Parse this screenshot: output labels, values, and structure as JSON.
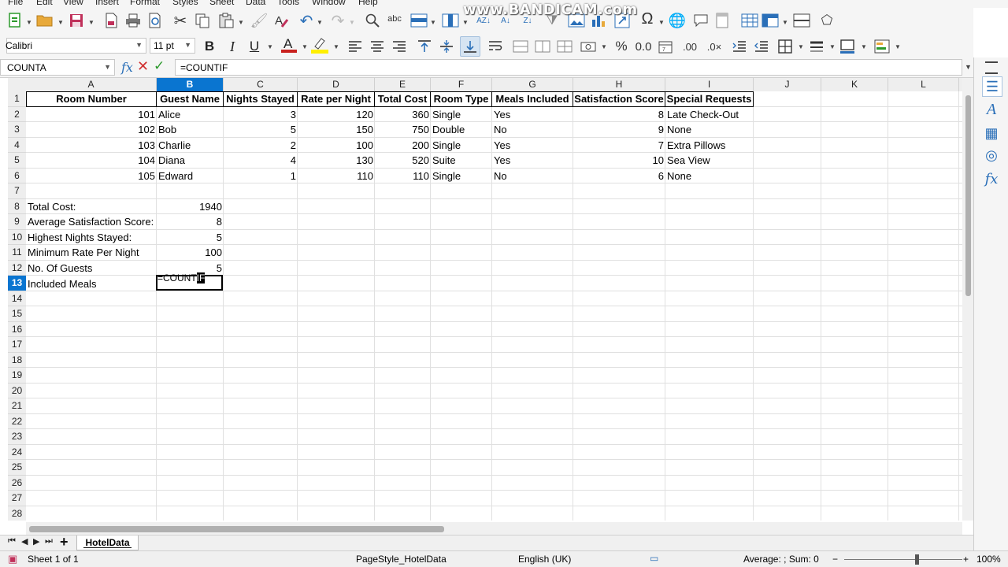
{
  "menu": [
    "File",
    "Edit",
    "View",
    "Insert",
    "Format",
    "Styles",
    "Sheet",
    "Data",
    "Tools",
    "Window",
    "Help"
  ],
  "watermark": "www.BANDICAM.com",
  "font": {
    "name": "Calibri",
    "size": "11 pt"
  },
  "formula_bar": {
    "name_box": "COUNTA",
    "formula": "=COUNTIF"
  },
  "columns": [
    "A",
    "B",
    "C",
    "D",
    "E",
    "F",
    "G",
    "H",
    "I",
    "J",
    "K",
    "L"
  ],
  "selected_column": "B",
  "rows": [
    "1",
    "2",
    "3",
    "4",
    "5",
    "6",
    "7",
    "8",
    "9",
    "10",
    "11",
    "12",
    "13",
    "14",
    "15",
    "16",
    "17",
    "18",
    "19",
    "20",
    "21",
    "22",
    "23",
    "24",
    "25",
    "26",
    "27",
    "28"
  ],
  "selected_row": "13",
  "table": {
    "headers": [
      "Room Number",
      "Guest Name",
      "Nights Stayed",
      "Rate per Night",
      "Total Cost",
      "Room Type",
      "Meals Included",
      "Satisfaction Score",
      "Special Requests"
    ],
    "rows": [
      [
        "101",
        "Alice",
        "3",
        "120",
        "360",
        "Single",
        "Yes",
        "8",
        "Late Check-Out"
      ],
      [
        "102",
        "Bob",
        "5",
        "150",
        "750",
        "Double",
        "No",
        "9",
        "None"
      ],
      [
        "103",
        "Charlie",
        "2",
        "100",
        "200",
        "Single",
        "Yes",
        "7",
        "Extra Pillows"
      ],
      [
        "104",
        "Diana",
        "4",
        "130",
        "520",
        "Suite",
        "Yes",
        "10",
        "Sea View"
      ],
      [
        "105",
        "Edward",
        "1",
        "110",
        "110",
        "Single",
        "No",
        "6",
        "None"
      ]
    ]
  },
  "summary": [
    {
      "label": "Total Cost:",
      "value": "1940"
    },
    {
      "label": "Average Satisfaction Score:",
      "value": "8"
    },
    {
      "label": "Highest Nights Stayed:",
      "value": "5"
    },
    {
      "label": "Minimum Rate Per Night",
      "value": "100"
    },
    {
      "label": "No. Of Guests",
      "value": "5"
    },
    {
      "label": "Included Meals",
      "value": ""
    }
  ],
  "editing": {
    "typed": "=COUNT",
    "cursor": "IF"
  },
  "sheet_tab": "HotelData",
  "status": {
    "sheet": "Sheet 1 of 1",
    "page_style": "PageStyle_HotelData",
    "language": "English (UK)",
    "stats": "Average: ; Sum: 0",
    "zoom": "100%"
  },
  "colors": {
    "selection": "#0a75d0",
    "cancel": "#d03030",
    "accept": "#2d9a2d"
  }
}
